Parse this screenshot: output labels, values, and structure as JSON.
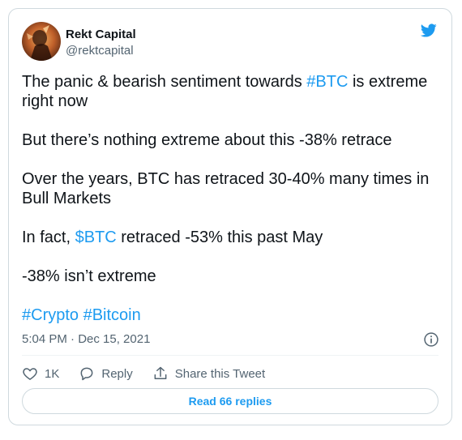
{
  "author": {
    "display_name": "Rekt Capital",
    "handle": "@rektcapital",
    "avatar_icon": "avatar-image"
  },
  "brand": {
    "icon": "twitter-bird-icon",
    "color": "#1d9bf0"
  },
  "tweet": {
    "line1_pre": "The panic & bearish sentiment towards ",
    "line1_link": "#BTC",
    "line1_post": " is extreme right now",
    "line2": "But there’s nothing extreme about this -38% retrace",
    "line3": "Over the years, BTC has retraced 30-40% many times in Bull Markets",
    "line4_pre": "In fact, ",
    "line4_link": "$BTC",
    "line4_post": " retraced -53% this past May",
    "line5": "-38% isn’t extreme",
    "hashtag1": "#Crypto",
    "hashtag2": "#Bitcoin"
  },
  "meta": {
    "timestamp": "5:04 PM · Dec 15, 2021",
    "info_icon": "info-icon"
  },
  "actions": {
    "like_count": "1K",
    "reply_label": "Reply",
    "share_label": "Share this Tweet"
  },
  "read_replies_label": "Read 66 replies",
  "colors": {
    "link": "#1d9bf0",
    "secondary_text": "#536471",
    "border": "#cfd9de"
  }
}
